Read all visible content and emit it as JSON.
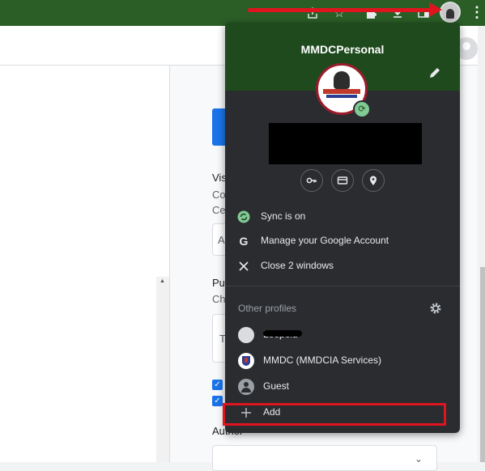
{
  "browser": {
    "toolbar_icons": [
      "share-icon",
      "star-icon",
      "puzzle-icon",
      "download-icon",
      "sidepanel-icon",
      "profile-avatar-icon",
      "kebab-menu-icon"
    ]
  },
  "page": {
    "heading_1": "Vis",
    "line_1": "Co",
    "line_2": "Ce",
    "box_letter": "A",
    "heading_2": "Pu",
    "line_3": "Ch",
    "box2_letter": "T",
    "heading_3": "Author"
  },
  "profile_menu": {
    "name": "MMDCPersonal",
    "actions": [
      {
        "label": "Sync is on",
        "icon": "sync-icon"
      },
      {
        "label": "Manage your Google Account",
        "icon": "google-g-icon"
      },
      {
        "label": "Close 2 windows",
        "icon": "close-icon"
      }
    ],
    "other_profiles_label": "Other profiles",
    "profiles": [
      {
        "label": "Leopold",
        "icon": "person-photo-icon"
      },
      {
        "label": "MMDC (MMDCIA Services)",
        "icon": "mmdc-logo-icon"
      },
      {
        "label": "Guest",
        "icon": "guest-icon"
      }
    ],
    "add_label": "Add",
    "colors": {
      "header_bg": "#1f4a1d",
      "menu_bg": "#2b2c2f",
      "sync_green": "#81c995",
      "highlight_red": "#e0141e"
    }
  }
}
